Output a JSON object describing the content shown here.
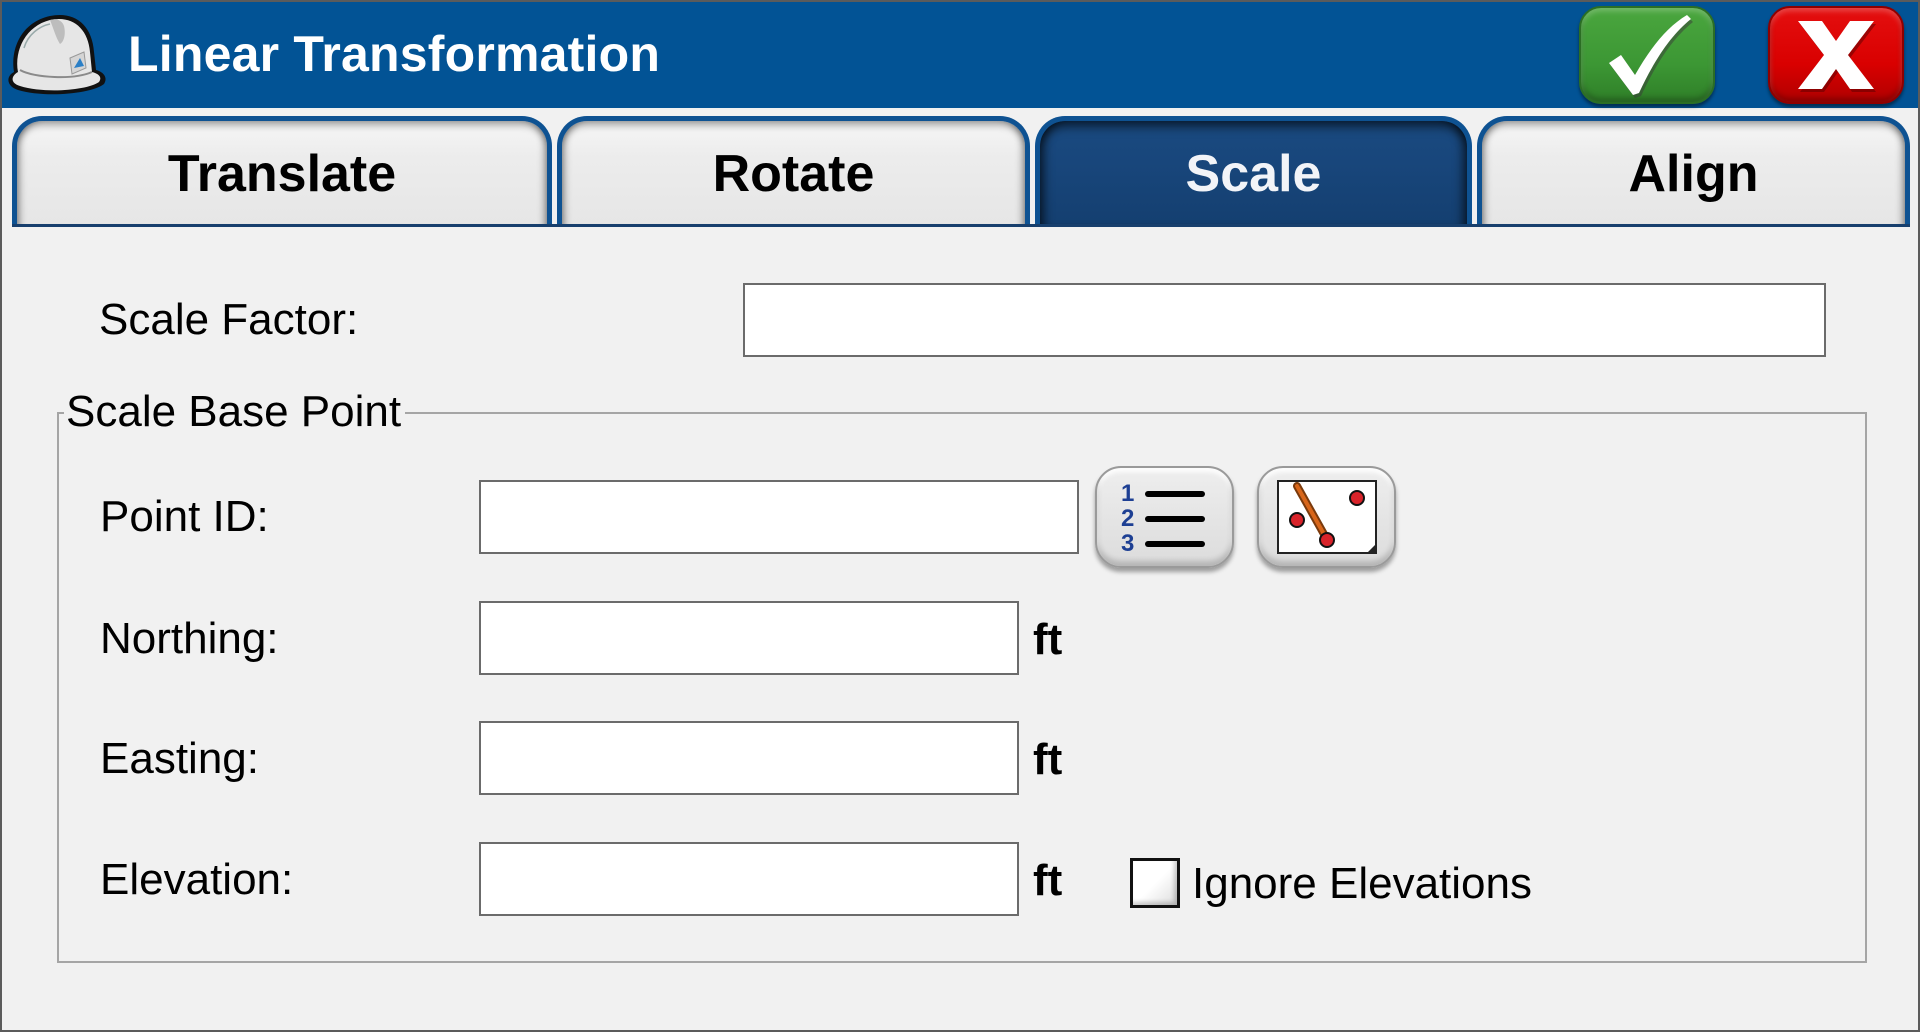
{
  "window": {
    "title": "Linear Transformation",
    "logo": "hardhat-logo-icon",
    "ok_icon": "checkmark-icon",
    "cancel_icon": "x-close-icon",
    "colors": {
      "header": "#025395",
      "ok": "#3c9734",
      "cancel": "#d90000",
      "active_tab": "#18467b"
    }
  },
  "tabs": [
    {
      "label": "Translate",
      "active": false
    },
    {
      "label": "Rotate",
      "active": false
    },
    {
      "label": "Scale",
      "active": true
    },
    {
      "label": "Align",
      "active": false
    }
  ],
  "form": {
    "scale_factor": {
      "label": "Scale Factor:",
      "value": ""
    },
    "group_title": "Scale Base Point",
    "point_id": {
      "label": "Point ID:",
      "value": ""
    },
    "northing": {
      "label": "Northing:",
      "value": "",
      "unit": "ft"
    },
    "easting": {
      "label": "Easting:",
      "value": "",
      "unit": "ft"
    },
    "elevation": {
      "label": "Elevation:",
      "value": "",
      "unit": "ft"
    },
    "ignore_elevations": {
      "label": "Ignore Elevations",
      "checked": false
    },
    "point_list_button": {
      "icon": "numbered-list-icon",
      "digits": [
        "1",
        "2",
        "3"
      ]
    },
    "map_pick_button": {
      "icon": "pick-from-map-icon"
    }
  }
}
